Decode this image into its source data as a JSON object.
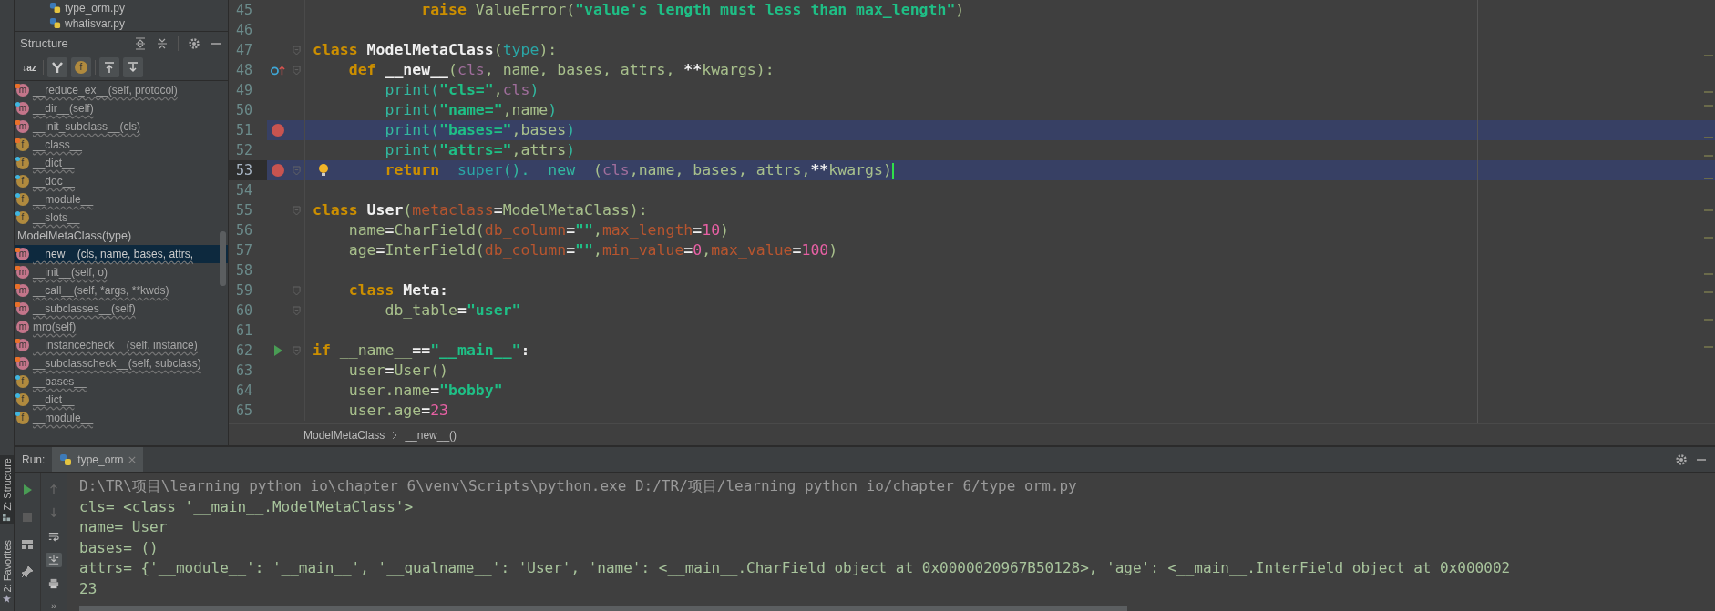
{
  "tool_strip": [
    {
      "kind": "structure",
      "label": "Z: Structure",
      "selected": true
    },
    {
      "kind": "favorites",
      "label": "2: Favorites",
      "selected": false
    }
  ],
  "project_files": [
    {
      "name": "type_orm.py"
    },
    {
      "name": "whatisvar.py"
    }
  ],
  "structure": {
    "title": "Structure",
    "toolbar": [
      {
        "kind": "sort",
        "glyph": "↓az",
        "selected": false
      },
      {
        "kind": "inherited",
        "selected": true
      },
      {
        "kind": "fields",
        "glyph": "f",
        "selected": true
      },
      {
        "kind": "scroll-to",
        "selected": true
      },
      {
        "kind": "scroll-from",
        "selected": true
      }
    ],
    "tree": [
      {
        "kind": "method",
        "glyph": "m",
        "lock": true,
        "dot": false,
        "text": "__reduce_ex__(self, protocol)",
        "selected": false
      },
      {
        "kind": "method",
        "glyph": "m",
        "lock": false,
        "dot": true,
        "text": "__dir__(self)",
        "selected": false
      },
      {
        "kind": "method",
        "glyph": "m",
        "lock": true,
        "dot": false,
        "text": "__init_subclass__(cls)",
        "selected": false
      },
      {
        "kind": "field",
        "glyph": "f",
        "lock": true,
        "dot": false,
        "text": "__class__",
        "selected": false
      },
      {
        "kind": "field",
        "glyph": "f",
        "lock": false,
        "dot": true,
        "text": "__dict__",
        "selected": false
      },
      {
        "kind": "field",
        "glyph": "f",
        "lock": false,
        "dot": true,
        "text": "__doc__",
        "selected": false
      },
      {
        "kind": "field",
        "glyph": "f",
        "lock": false,
        "dot": true,
        "text": "__module__",
        "selected": false
      },
      {
        "kind": "field",
        "glyph": "f",
        "lock": false,
        "dot": true,
        "text": "__slots__",
        "selected": false
      },
      {
        "kind": "class",
        "text": "ModelMetaClass(type)",
        "selected": false,
        "children": [
          {
            "kind": "method",
            "glyph": "m",
            "lock": true,
            "dot": false,
            "text": "__new__(cls, name, bases, attrs,",
            "selected": true
          },
          {
            "kind": "method",
            "glyph": "m",
            "lock": true,
            "dot": false,
            "text": "__init__(self, o)",
            "selected": false
          },
          {
            "kind": "method",
            "glyph": "m",
            "lock": true,
            "dot": false,
            "text": "__call__(self, *args, **kwds)",
            "selected": false
          },
          {
            "kind": "method",
            "glyph": "m",
            "lock": true,
            "dot": false,
            "text": "__subclasses__(self)",
            "selected": false
          },
          {
            "kind": "method",
            "glyph": "m",
            "lock": false,
            "dot": false,
            "text": "mro(self)",
            "selected": false
          },
          {
            "kind": "method",
            "glyph": "m",
            "lock": true,
            "dot": false,
            "text": "__instancecheck__(self, instance)",
            "selected": false
          },
          {
            "kind": "method",
            "glyph": "m",
            "lock": true,
            "dot": false,
            "text": "__subclasscheck__(self, subclass)",
            "selected": false
          },
          {
            "kind": "field",
            "glyph": "f",
            "lock": false,
            "dot": true,
            "text": "__bases__",
            "selected": false
          },
          {
            "kind": "field",
            "glyph": "f",
            "lock": false,
            "dot": true,
            "text": "__dict__",
            "selected": false
          },
          {
            "kind": "field",
            "glyph": "f",
            "lock": false,
            "dot": true,
            "text": "__module__",
            "selected": false
          }
        ]
      }
    ]
  },
  "editor": {
    "lines": [
      {
        "number": "45",
        "breakpoint": false,
        "current": false,
        "fold": false,
        "kind": "plain",
        "tokens": [
          {
            "kind": "kw",
            "text": "            raise"
          },
          {
            "kind": "plain",
            "text": " ValueError("
          },
          {
            "kind": "str",
            "text": "\"value's length must less than max_length\""
          },
          {
            "kind": "plain",
            "text": ")"
          }
        ]
      },
      {
        "number": "46",
        "breakpoint": false,
        "current": false,
        "fold": false,
        "kind": "plain"
      },
      {
        "number": "47",
        "breakpoint": false,
        "current": false,
        "fold": true,
        "kind": "plain",
        "tokens": [
          {
            "kind": "kw",
            "text": "class "
          },
          {
            "kind": "name",
            "text": "ModelMetaClass"
          },
          {
            "kind": "plain",
            "text": "("
          },
          {
            "kind": "builtin",
            "text": "type"
          },
          {
            "kind": "plain",
            "text": "):"
          }
        ]
      },
      {
        "number": "48",
        "breakpoint": false,
        "current": false,
        "fold": true,
        "kind": "override",
        "tokens": [
          {
            "kind": "kw",
            "text": "    def "
          },
          {
            "kind": "name",
            "text": "__new__"
          },
          {
            "kind": "plain",
            "text": "("
          },
          {
            "kind": "param",
            "text": "cls"
          },
          {
            "kind": "plain",
            "text": ", name, bases, attrs, "
          },
          {
            "kind": "op",
            "text": "**"
          },
          {
            "kind": "plain",
            "text": "kwargs):"
          }
        ]
      },
      {
        "number": "49",
        "breakpoint": false,
        "current": false,
        "fold": false,
        "kind": "plain",
        "tokens": [
          {
            "kind": "call",
            "text": "        print("
          },
          {
            "kind": "str",
            "text": "\"cls=\""
          },
          {
            "kind": "plain",
            "text": ","
          },
          {
            "kind": "param",
            "text": "cls"
          },
          {
            "kind": "call",
            "text": ")"
          }
        ]
      },
      {
        "number": "50",
        "breakpoint": false,
        "current": false,
        "fold": false,
        "kind": "plain",
        "tokens": [
          {
            "kind": "call",
            "text": "        print("
          },
          {
            "kind": "str",
            "text": "\"name=\""
          },
          {
            "kind": "plain",
            "text": ",name"
          },
          {
            "kind": "call",
            "text": ")"
          }
        ]
      },
      {
        "number": "51",
        "breakpoint": true,
        "current": false,
        "fold": false,
        "kind": "plain",
        "tokens": [
          {
            "kind": "call",
            "text": "        print("
          },
          {
            "kind": "str",
            "text": "\"bases=\""
          },
          {
            "kind": "plain",
            "text": ",bases"
          },
          {
            "kind": "call",
            "text": ")"
          }
        ]
      },
      {
        "number": "52",
        "breakpoint": false,
        "current": false,
        "fold": false,
        "kind": "plain",
        "tokens": [
          {
            "kind": "call",
            "text": "        print("
          },
          {
            "kind": "str",
            "text": "\"attrs=\""
          },
          {
            "kind": "plain",
            "text": ",attrs"
          },
          {
            "kind": "call",
            "text": ")"
          }
        ]
      },
      {
        "number": "53",
        "breakpoint": true,
        "current": true,
        "fold": true,
        "kind": "bulb",
        "tokens": [
          {
            "kind": "kw",
            "text": "        return  "
          },
          {
            "kind": "builtin",
            "text": "super"
          },
          {
            "kind": "call",
            "text": "().__new__"
          },
          {
            "kind": "plain",
            "text": "("
          },
          {
            "kind": "param",
            "text": "cls"
          },
          {
            "kind": "plain",
            "text": ",name, bases, attrs,"
          },
          {
            "kind": "op",
            "text": "**"
          },
          {
            "kind": "plain",
            "text": "kwargs)"
          }
        ]
      },
      {
        "number": "54",
        "breakpoint": false,
        "current": false,
        "fold": false,
        "kind": "plain"
      },
      {
        "number": "55",
        "breakpoint": false,
        "current": false,
        "fold": true,
        "kind": "plain",
        "tokens": [
          {
            "kind": "kw",
            "text": "class "
          },
          {
            "kind": "name",
            "text": "User"
          },
          {
            "kind": "plain",
            "text": "("
          },
          {
            "kind": "kwarg",
            "text": "metaclass"
          },
          {
            "kind": "op",
            "text": "="
          },
          {
            "kind": "plain",
            "text": "ModelMetaClass):"
          }
        ]
      },
      {
        "number": "56",
        "breakpoint": false,
        "current": false,
        "fold": false,
        "kind": "plain",
        "tokens": [
          {
            "kind": "plain",
            "text": "    name"
          },
          {
            "kind": "op",
            "text": "="
          },
          {
            "kind": "plain",
            "text": "CharField("
          },
          {
            "kind": "kwarg",
            "text": "db_column"
          },
          {
            "kind": "op",
            "text": "="
          },
          {
            "kind": "str",
            "text": "\"\""
          },
          {
            "kind": "plain",
            "text": ","
          },
          {
            "kind": "kwarg",
            "text": "max_length"
          },
          {
            "kind": "op",
            "text": "="
          },
          {
            "kind": "num",
            "text": "10"
          },
          {
            "kind": "plain",
            "text": ")"
          }
        ]
      },
      {
        "number": "57",
        "breakpoint": false,
        "current": false,
        "fold": false,
        "kind": "plain",
        "tokens": [
          {
            "kind": "plain",
            "text": "    age"
          },
          {
            "kind": "op",
            "text": "="
          },
          {
            "kind": "plain",
            "text": "InterField("
          },
          {
            "kind": "kwarg",
            "text": "db_column"
          },
          {
            "kind": "op",
            "text": "="
          },
          {
            "kind": "str",
            "text": "\"\""
          },
          {
            "kind": "plain",
            "text": ","
          },
          {
            "kind": "kwarg",
            "text": "min_value"
          },
          {
            "kind": "op",
            "text": "="
          },
          {
            "kind": "num",
            "text": "0"
          },
          {
            "kind": "plain",
            "text": ","
          },
          {
            "kind": "kwarg",
            "text": "max_value"
          },
          {
            "kind": "op",
            "text": "="
          },
          {
            "kind": "num",
            "text": "100"
          },
          {
            "kind": "plain",
            "text": ")"
          }
        ]
      },
      {
        "number": "58",
        "breakpoint": false,
        "current": false,
        "fold": false,
        "kind": "plain"
      },
      {
        "number": "59",
        "breakpoint": false,
        "current": false,
        "fold": true,
        "kind": "plain",
        "tokens": [
          {
            "kind": "kw",
            "text": "    class "
          },
          {
            "kind": "name",
            "text": "Meta"
          },
          {
            "kind": "op",
            "text": ":"
          }
        ]
      },
      {
        "number": "60",
        "breakpoint": false,
        "current": false,
        "fold": true,
        "kind": "plain",
        "tokens": [
          {
            "kind": "plain",
            "text": "        db_table"
          },
          {
            "kind": "op",
            "text": "="
          },
          {
            "kind": "str",
            "text": "\"user\""
          }
        ]
      },
      {
        "number": "61",
        "breakpoint": false,
        "current": false,
        "fold": false,
        "kind": "plain"
      },
      {
        "number": "62",
        "breakpoint": false,
        "current": false,
        "fold": true,
        "kind": "run",
        "tokens": [
          {
            "kind": "kw",
            "text": "if"
          },
          {
            "kind": "plain",
            "text": " __name__"
          },
          {
            "kind": "op",
            "text": "=="
          },
          {
            "kind": "str",
            "text": "\"__main__\""
          },
          {
            "kind": "op",
            "text": ":"
          }
        ]
      },
      {
        "number": "63",
        "breakpoint": false,
        "current": false,
        "fold": false,
        "kind": "plain",
        "tokens": [
          {
            "kind": "plain",
            "text": "    user"
          },
          {
            "kind": "op",
            "text": "="
          },
          {
            "kind": "plain",
            "text": "User()"
          }
        ]
      },
      {
        "number": "64",
        "breakpoint": false,
        "current": false,
        "fold": false,
        "kind": "plain",
        "tokens": [
          {
            "kind": "plain",
            "text": "    user.name"
          },
          {
            "kind": "op",
            "text": "="
          },
          {
            "kind": "str",
            "text": "\"bobby\""
          }
        ]
      },
      {
        "number": "65",
        "breakpoint": false,
        "current": false,
        "fold": false,
        "kind": "plain",
        "tokens": [
          {
            "kind": "plain",
            "text": "    user.age"
          },
          {
            "kind": "op",
            "text": "="
          },
          {
            "kind": "num",
            "text": "23"
          }
        ]
      }
    ],
    "breadcrumbs": [
      {
        "label": "ModelMetaClass"
      },
      {
        "label": "__new__()"
      }
    ]
  },
  "run": {
    "label": "Run:",
    "tabs": [
      {
        "label": "type_orm",
        "selected": true
      }
    ],
    "left_tools": [
      {
        "kind": "rerun"
      },
      {
        "kind": "stop",
        "disabled": true
      },
      {
        "kind": "layout"
      },
      {
        "kind": "pin"
      }
    ],
    "right_tools": [
      {
        "kind": "up",
        "disabled": true
      },
      {
        "kind": "down",
        "disabled": true
      },
      {
        "kind": "wrap",
        "selected": false
      },
      {
        "kind": "scroll-end",
        "selected": true
      },
      {
        "kind": "print"
      }
    ],
    "more": "»",
    "output": [
      {
        "kind": "command",
        "text": "D:\\TR\\项目\\learning_python_io\\chapter_6\\venv\\Scripts\\python.exe D:/TR/项目/learning_python_io/chapter_6/type_orm.py"
      },
      {
        "kind": "stdout",
        "text": "cls= <class '__main__.ModelMetaClass'>"
      },
      {
        "kind": "stdout",
        "text": "name= User"
      },
      {
        "kind": "stdout",
        "text": "bases= ()"
      },
      {
        "kind": "stdout",
        "text": "attrs= {'__module__': '__main__', '__qualname__': 'User', 'name': <__main__.CharField object at 0x0000020967B50128>, 'age': <__main__.InterField object at 0x000002"
      },
      {
        "kind": "stdout",
        "text": "23"
      }
    ]
  }
}
